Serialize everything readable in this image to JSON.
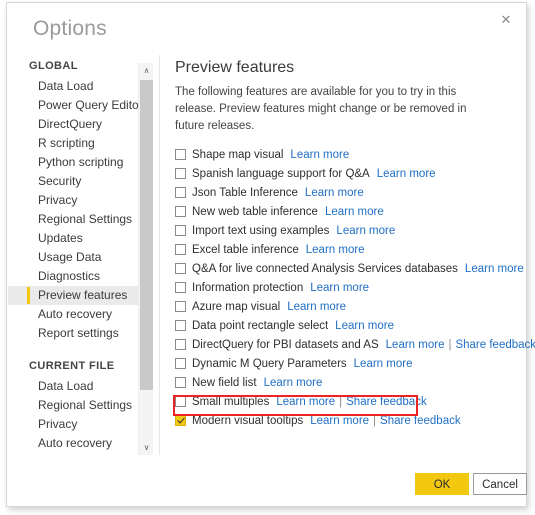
{
  "dialog": {
    "title": "Options",
    "close_label": "✕"
  },
  "sidebar": {
    "groups": [
      {
        "header": "GLOBAL",
        "items": [
          {
            "label": "Data Load",
            "selected": false
          },
          {
            "label": "Power Query Editor",
            "selected": false
          },
          {
            "label": "DirectQuery",
            "selected": false
          },
          {
            "label": "R scripting",
            "selected": false
          },
          {
            "label": "Python scripting",
            "selected": false
          },
          {
            "label": "Security",
            "selected": false
          },
          {
            "label": "Privacy",
            "selected": false
          },
          {
            "label": "Regional Settings",
            "selected": false
          },
          {
            "label": "Updates",
            "selected": false
          },
          {
            "label": "Usage Data",
            "selected": false
          },
          {
            "label": "Diagnostics",
            "selected": false
          },
          {
            "label": "Preview features",
            "selected": true
          },
          {
            "label": "Auto recovery",
            "selected": false
          },
          {
            "label": "Report settings",
            "selected": false
          }
        ]
      },
      {
        "header": "CURRENT FILE",
        "items": [
          {
            "label": "Data Load",
            "selected": false
          },
          {
            "label": "Regional Settings",
            "selected": false
          },
          {
            "label": "Privacy",
            "selected": false
          },
          {
            "label": "Auto recovery",
            "selected": false
          }
        ]
      }
    ],
    "scrollbar": {
      "up_glyph": "∧",
      "down_glyph": "∨"
    }
  },
  "main": {
    "title": "Preview features",
    "description": "The following features are available for you to try in this release. Preview features might change or be removed in future releases.",
    "separator": "|",
    "features": [
      {
        "label": "Shape map visual",
        "checked": false,
        "links": [
          "Learn more"
        ]
      },
      {
        "label": "Spanish language support for Q&A",
        "checked": false,
        "links": [
          "Learn more"
        ]
      },
      {
        "label": "Json Table Inference",
        "checked": false,
        "links": [
          "Learn more"
        ]
      },
      {
        "label": "New web table inference",
        "checked": false,
        "links": [
          "Learn more"
        ]
      },
      {
        "label": "Import text using examples",
        "checked": false,
        "links": [
          "Learn more"
        ]
      },
      {
        "label": "Excel table inference",
        "checked": false,
        "links": [
          "Learn more"
        ]
      },
      {
        "label": "Q&A for live connected Analysis Services databases",
        "checked": false,
        "links": [
          "Learn more"
        ]
      },
      {
        "label": "Information protection",
        "checked": false,
        "links": [
          "Learn more"
        ]
      },
      {
        "label": "Azure map visual",
        "checked": false,
        "links": [
          "Learn more"
        ]
      },
      {
        "label": "Data point rectangle select",
        "checked": false,
        "links": [
          "Learn more"
        ]
      },
      {
        "label": "DirectQuery for PBI datasets and AS",
        "checked": false,
        "links": [
          "Learn more",
          "Share feedback"
        ]
      },
      {
        "label": "Dynamic M Query Parameters",
        "checked": false,
        "links": [
          "Learn more"
        ]
      },
      {
        "label": "New field list",
        "checked": false,
        "links": [
          "Learn more"
        ]
      },
      {
        "label": "Small multiples",
        "checked": false,
        "links": [
          "Learn more",
          "Share feedback"
        ]
      },
      {
        "label": "Modern visual tooltips",
        "checked": true,
        "highlighted": true,
        "links": [
          "Learn more",
          "Share feedback"
        ]
      }
    ]
  },
  "footer": {
    "ok_label": "OK",
    "cancel_label": "Cancel"
  },
  "colors": {
    "accent_yellow": "#f2c811",
    "link_blue": "#1f6fc4",
    "highlight_red": "#ee2222",
    "selected_row_bg": "#eaeaea"
  }
}
